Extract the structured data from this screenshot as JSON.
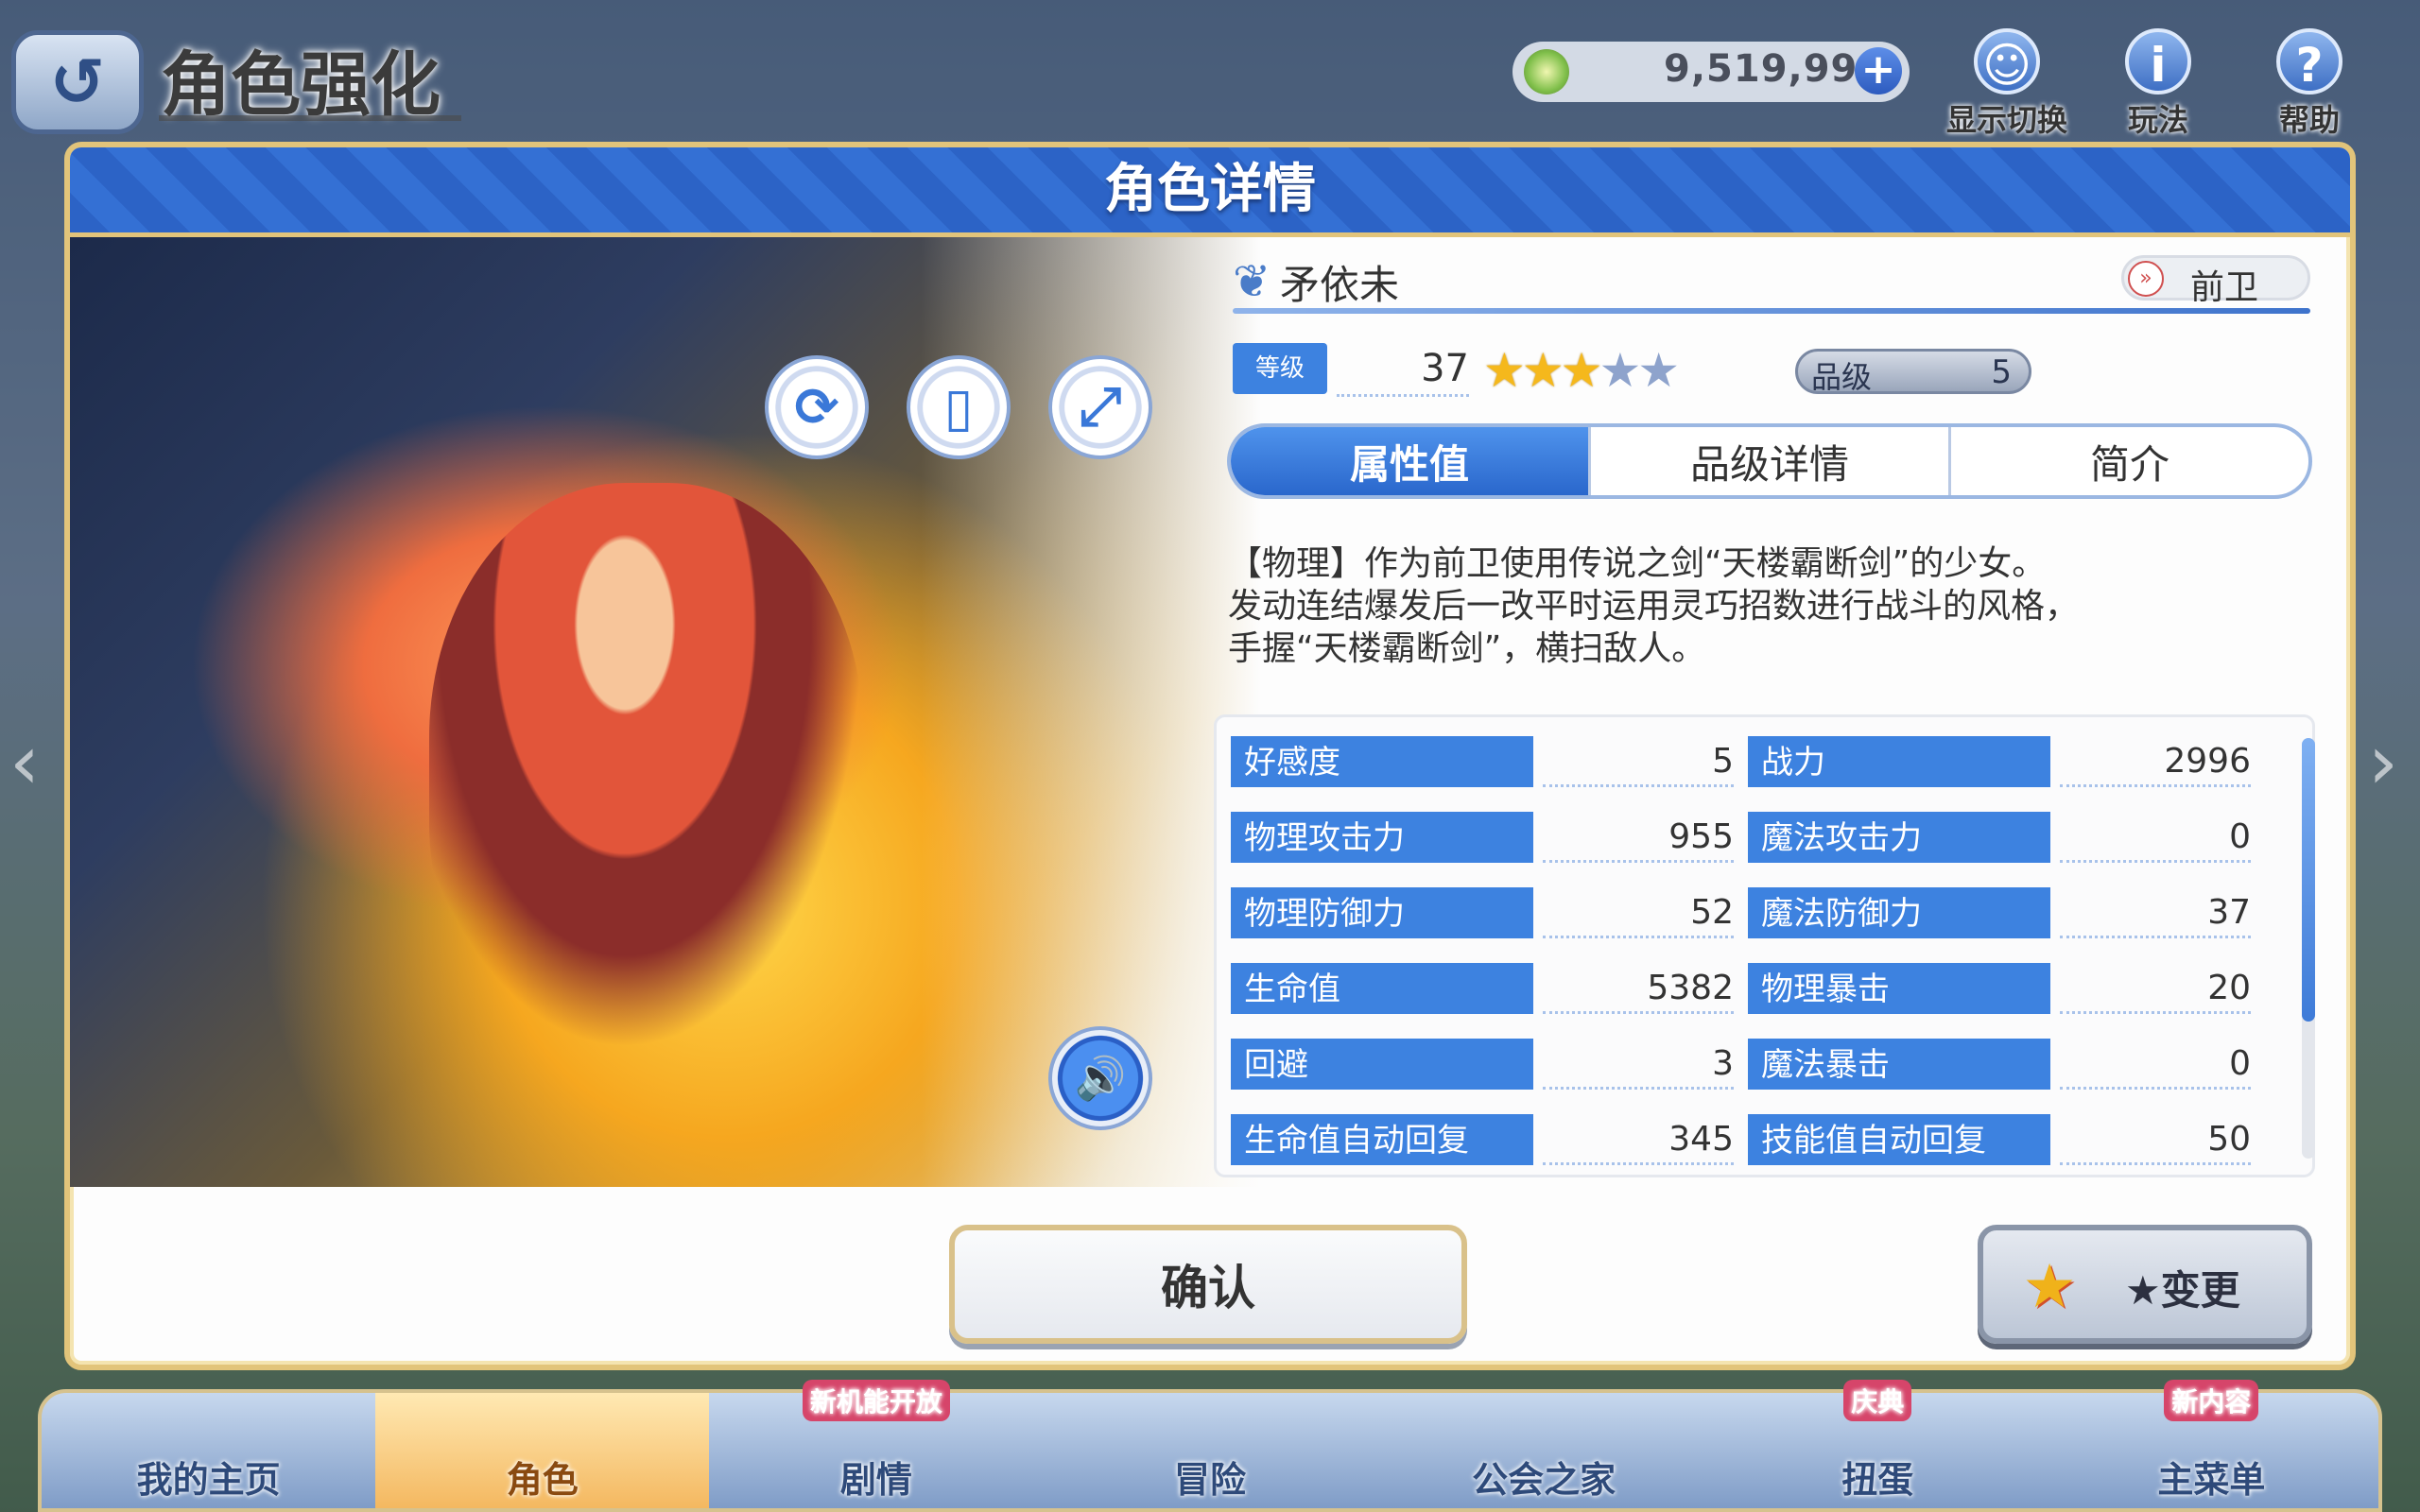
{
  "header": {
    "back_icon": "back-arrow-icon",
    "title": "角色强化",
    "currency_value": "9,519,999",
    "currency_add_glyph": "+",
    "icons": [
      {
        "label": "显示切换",
        "glyph": "☺"
      },
      {
        "label": "玩法",
        "glyph": "i"
      },
      {
        "label": "帮助",
        "glyph": "?"
      }
    ]
  },
  "modal": {
    "title": "角色详情",
    "art_buttons": {
      "rotate": "⟳",
      "layout": "▯",
      "expand": "⤢",
      "voice": "🔊"
    },
    "character": {
      "name": "矛依未",
      "role": "前卫",
      "level_label": "等级",
      "level": "37",
      "stars_on": "★★★",
      "stars_off": "★★",
      "star_count": 3,
      "star_max": 5,
      "rank_label": "品级",
      "rank": "5"
    },
    "tabs": [
      "属性值",
      "品级详情",
      "简介"
    ],
    "active_tab": 0,
    "description": [
      "【物理】作为前卫使用传说之剑“天楼霸断剑”的少女。",
      "发动连结爆发后一改平时运用灵巧招数进行战斗的风格，",
      "手握“天楼霸断剑”，横扫敌人。"
    ],
    "stats": [
      {
        "label": "好感度",
        "value": "5"
      },
      {
        "label": "战力",
        "value": "2996"
      },
      {
        "label": "物理攻击力",
        "value": "955"
      },
      {
        "label": "魔法攻击力",
        "value": "0"
      },
      {
        "label": "物理防御力",
        "value": "52"
      },
      {
        "label": "魔法防御力",
        "value": "37"
      },
      {
        "label": "生命值",
        "value": "5382"
      },
      {
        "label": "物理暴击",
        "value": "20"
      },
      {
        "label": "回避",
        "value": "3"
      },
      {
        "label": "魔法暴击",
        "value": "0"
      },
      {
        "label": "生命值自动回复",
        "value": "345"
      },
      {
        "label": "技能值自动回复",
        "value": "50"
      }
    ],
    "confirm_label": "确认",
    "change_label": "★变更"
  },
  "bottom_nav": {
    "items": [
      {
        "label": "我的主页",
        "badge": ""
      },
      {
        "label": "角色",
        "badge": ""
      },
      {
        "label": "剧情",
        "badge": "新机能开放"
      },
      {
        "label": "冒险",
        "badge": ""
      },
      {
        "label": "公会之家",
        "badge": ""
      },
      {
        "label": "扭蛋",
        "badge": "庆典"
      },
      {
        "label": "主菜单",
        "badge": "新内容"
      }
    ],
    "active": 1
  },
  "colors": {
    "accent_blue": "#3d82e0",
    "gold_border": "#e2c47a",
    "star_gold": "#f5b81c"
  }
}
